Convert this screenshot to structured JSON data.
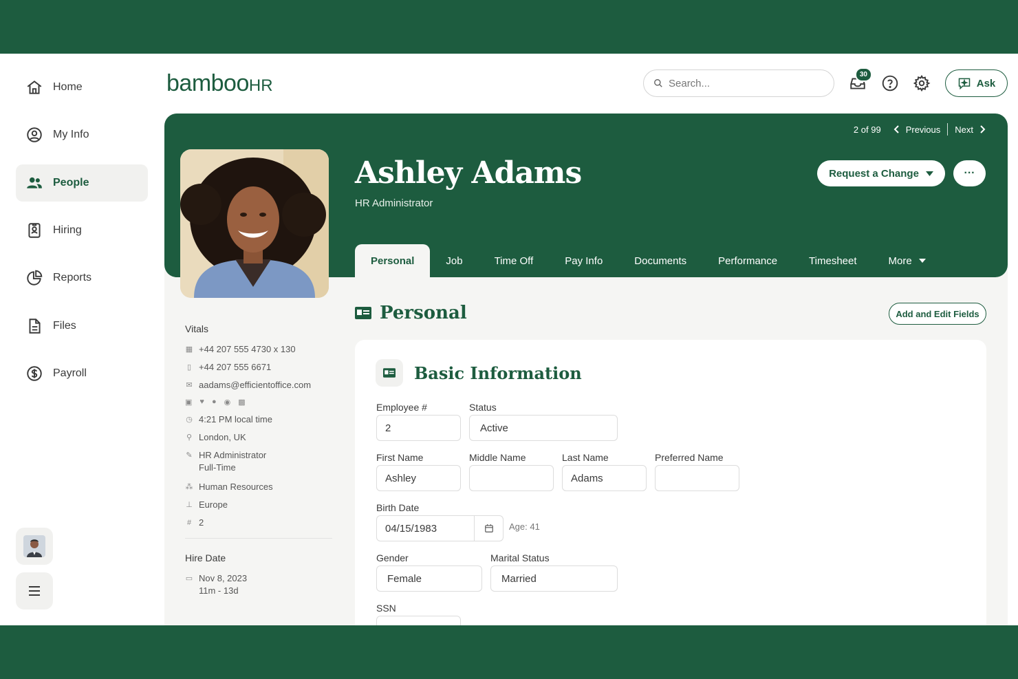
{
  "app": {
    "logo_text": "bamboo",
    "logo_hr": "HR"
  },
  "sidebar": {
    "items": [
      {
        "label": "Home",
        "icon": "home-icon"
      },
      {
        "label": "My Info",
        "icon": "user-circle-icon"
      },
      {
        "label": "People",
        "icon": "people-icon",
        "active": true
      },
      {
        "label": "Hiring",
        "icon": "badge-icon"
      },
      {
        "label": "Reports",
        "icon": "pie-chart-icon"
      },
      {
        "label": "Files",
        "icon": "file-icon"
      },
      {
        "label": "Payroll",
        "icon": "dollar-icon"
      }
    ]
  },
  "header": {
    "search_placeholder": "Search...",
    "notification_count": "30",
    "ask_label": "Ask"
  },
  "profile": {
    "pager_text": "2 of 99",
    "previous_label": "Previous",
    "next_label": "Next",
    "name": "Ashley Adams",
    "role": "HR Administrator",
    "request_change_label": "Request a Change",
    "more_label": "···",
    "tabs": [
      "Personal",
      "Job",
      "Time Off",
      "Pay Info",
      "Documents",
      "Performance",
      "Timesheet",
      "More"
    ]
  },
  "vitals": {
    "title": "Vitals",
    "work_phone": "+44 207 555 4730 x 130",
    "mobile_phone": "+44 207 555 6671",
    "email": "aadams@efficientoffice.com",
    "local_time": "4:21 PM local time",
    "location": "London, UK",
    "job_title": "HR Administrator",
    "employment_type": "Full-Time",
    "department": "Human Resources",
    "division": "Europe",
    "employee_number": "2",
    "hire_title": "Hire Date",
    "hire_date": "Nov 8, 2023",
    "tenure": "11m - 13d"
  },
  "personal": {
    "section_title": "Personal",
    "add_edit_label": "Add and Edit Fields",
    "card_title": "Basic Information",
    "fields": {
      "employee_no": {
        "label": "Employee #",
        "value": "2"
      },
      "status": {
        "label": "Status",
        "value": "Active"
      },
      "first_name": {
        "label": "First Name",
        "value": "Ashley"
      },
      "middle_name": {
        "label": "Middle Name",
        "value": ""
      },
      "last_name": {
        "label": "Last Name",
        "value": "Adams"
      },
      "preferred_name": {
        "label": "Preferred Name",
        "value": ""
      },
      "birth_date": {
        "label": "Birth Date",
        "value": "04/15/1983",
        "age": "Age: 41"
      },
      "gender": {
        "label": "Gender",
        "value": "Female"
      },
      "marital_status": {
        "label": "Marital Status",
        "value": "Married"
      },
      "ssn": {
        "label": "SSN",
        "value": ""
      }
    }
  },
  "colors": {
    "brand": "#1d5c3f",
    "surface": "#f5f5f3"
  }
}
